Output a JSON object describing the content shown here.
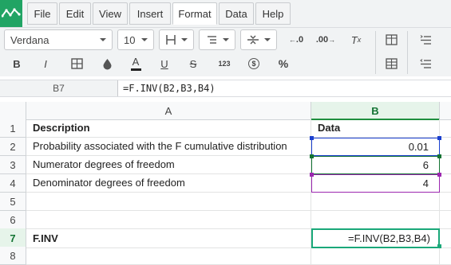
{
  "menu": {
    "items": [
      {
        "label": "File"
      },
      {
        "label": "Edit"
      },
      {
        "label": "View"
      },
      {
        "label": "Insert"
      },
      {
        "label": "Format",
        "active": true
      },
      {
        "label": "Data"
      },
      {
        "label": "Help"
      }
    ]
  },
  "toolbar": {
    "font_family": "Verdana",
    "font_size": "10",
    "number_format_label": "123",
    "bold_label": "B",
    "italic_label": "I",
    "font_color_label": "A",
    "underline_label": "U",
    "strike_label": "S",
    "currency_label": "$",
    "percent_label": "%",
    "decimal_decrease_label": ".0",
    "decimal_increase_label": ".00",
    "clear_format_label": "T",
    "underline_color": "#222222"
  },
  "formula_bar": {
    "cell_ref": "B7",
    "formula": "=F.INV(B2,B3,B4)"
  },
  "sheet": {
    "columns": [
      "A",
      "B"
    ],
    "rows": [
      "1",
      "2",
      "3",
      "4",
      "5",
      "6",
      "7",
      "8"
    ],
    "cells": {
      "A1": "Description",
      "B1": "Data",
      "A2": "Probability associated with the F cumulative distribution",
      "B2": "0.01",
      "A3": "Numerator degrees of freedom",
      "B3": "6",
      "A4": "Denominator degrees of freedom",
      "B4": "4",
      "A7": "F.INV",
      "B7": "=F.INV(B2,B3,B4)"
    },
    "active_cell": "B7",
    "reference_colors": {
      "B2": "#1a3fcf",
      "B3": "#137333",
      "B4": "#9c27b0",
      "active": "#1aa879"
    }
  }
}
